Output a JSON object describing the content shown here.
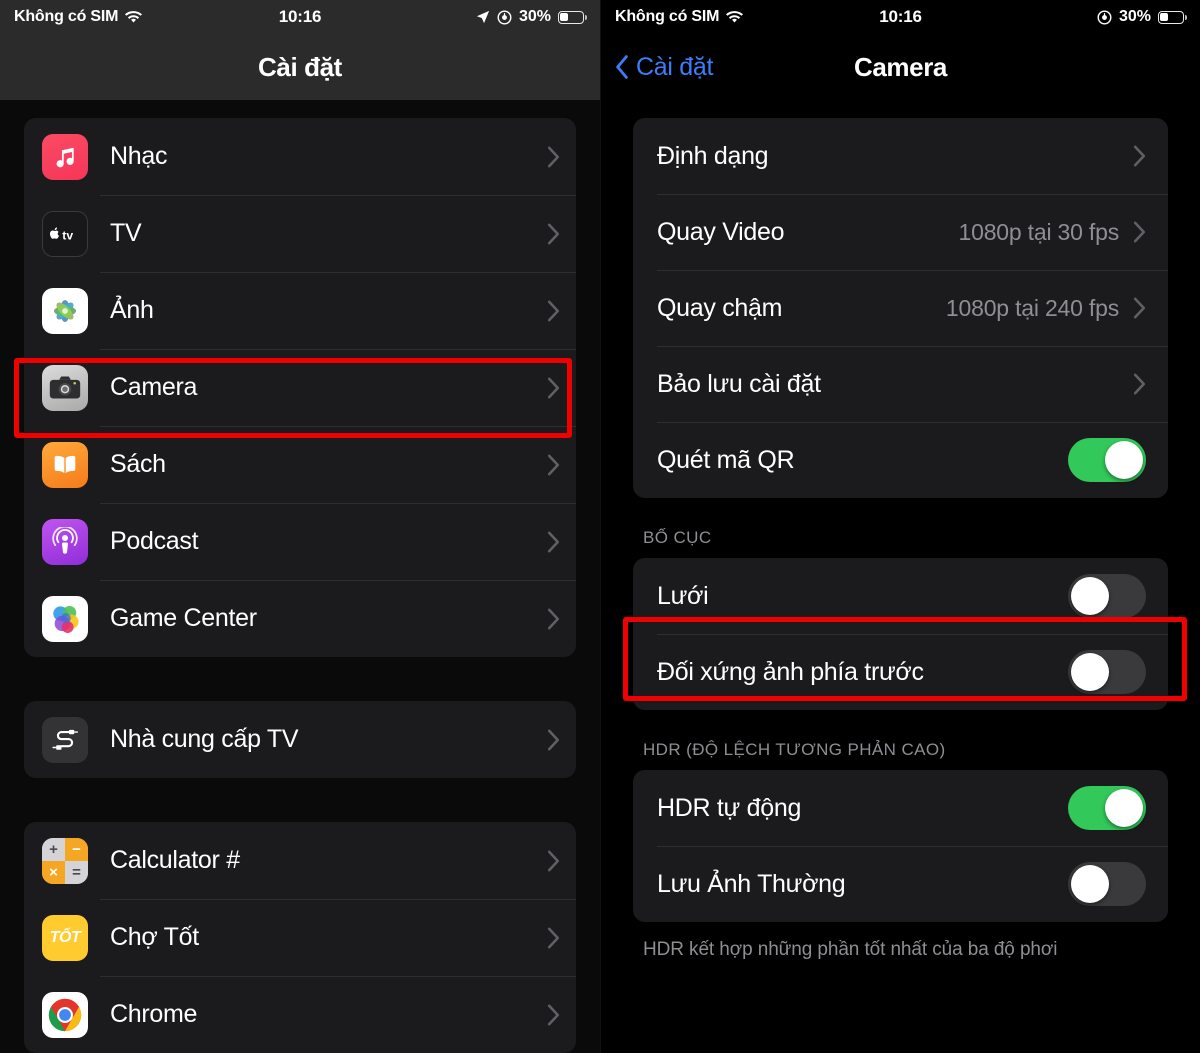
{
  "left": {
    "status": {
      "carrier": "Không có SIM",
      "wifi_icon": "wifi-icon",
      "time": "10:16",
      "location_icon": "location-arrow-icon",
      "alarm_icon": "alarm-clock-icon",
      "battery_text": "30%",
      "battery_icon": "battery-icon"
    },
    "nav": {
      "title": "Cài đặt"
    },
    "groups": [
      {
        "rows": [
          {
            "label": "Nhạc",
            "icon": "music-app-icon",
            "chevron": "chevron-right-icon"
          },
          {
            "label": "TV",
            "icon": "tv-app-icon",
            "chevron": "chevron-right-icon"
          },
          {
            "label": "Ảnh",
            "icon": "photos-app-icon",
            "chevron": "chevron-right-icon"
          },
          {
            "label": "Camera",
            "icon": "camera-app-icon",
            "chevron": "chevron-right-icon",
            "highlighted": true
          },
          {
            "label": "Sách",
            "icon": "books-app-icon",
            "chevron": "chevron-right-icon"
          },
          {
            "label": "Podcast",
            "icon": "podcasts-app-icon",
            "chevron": "chevron-right-icon"
          },
          {
            "label": "Game Center",
            "icon": "game-center-app-icon",
            "chevron": "chevron-right-icon"
          }
        ]
      },
      {
        "rows": [
          {
            "label": "Nhà cung cấp TV",
            "icon": "tv-provider-icon",
            "chevron": "chevron-right-icon"
          }
        ]
      },
      {
        "rows": [
          {
            "label": "Calculator #",
            "icon": "calculator-app-icon",
            "chevron": "chevron-right-icon"
          },
          {
            "label": "Chợ Tốt",
            "icon": "cho-tot-app-icon",
            "icon_text": "TỐT",
            "chevron": "chevron-right-icon"
          },
          {
            "label": "Chrome",
            "icon": "chrome-app-icon",
            "chevron": "chevron-right-icon"
          }
        ]
      }
    ]
  },
  "right": {
    "status": {
      "carrier": "Không có SIM",
      "wifi_icon": "wifi-icon",
      "time": "10:16",
      "alarm_icon": "alarm-clock-icon",
      "battery_text": "30%",
      "battery_icon": "battery-icon"
    },
    "nav": {
      "back_label": "Cài đặt",
      "back_icon": "chevron-left-icon",
      "title": "Camera"
    },
    "sections": [
      {
        "header": "",
        "footer": "",
        "rows": [
          {
            "label": "Định dạng",
            "type": "link",
            "value": "",
            "chevron": "chevron-right-icon"
          },
          {
            "label": "Quay Video",
            "type": "link",
            "value": "1080p tại 30 fps",
            "chevron": "chevron-right-icon"
          },
          {
            "label": "Quay chậm",
            "type": "link",
            "value": "1080p tại 240 fps",
            "chevron": "chevron-right-icon"
          },
          {
            "label": "Bảo lưu cài đặt",
            "type": "link",
            "value": "",
            "chevron": "chevron-right-icon"
          },
          {
            "label": "Quét mã QR",
            "type": "toggle",
            "on": true
          }
        ]
      },
      {
        "header": "BỐ CỤC",
        "footer": "",
        "rows": [
          {
            "label": "Lưới",
            "type": "toggle",
            "on": false,
            "highlighted": true
          },
          {
            "label": "Đối xứng ảnh phía trước",
            "type": "toggle",
            "on": false
          }
        ]
      },
      {
        "header": "HDR (ĐỘ LỆCH TƯƠNG PHẢN CAO)",
        "footer": "HDR kết hợp những phần tốt nhất của ba độ phơi",
        "rows": [
          {
            "label": "HDR tự động",
            "type": "toggle",
            "on": true
          },
          {
            "label": "Lưu Ảnh Thường",
            "type": "toggle",
            "on": false
          }
        ]
      }
    ]
  },
  "colors": {
    "accent_blue": "#3b7dfb",
    "toggle_on_green": "#32c85a",
    "toggle_off_gray": "#3a3a3c",
    "highlight_red": "#f00000",
    "card_bg": "#1b1b1d",
    "secondary_text": "#8e8e93"
  }
}
